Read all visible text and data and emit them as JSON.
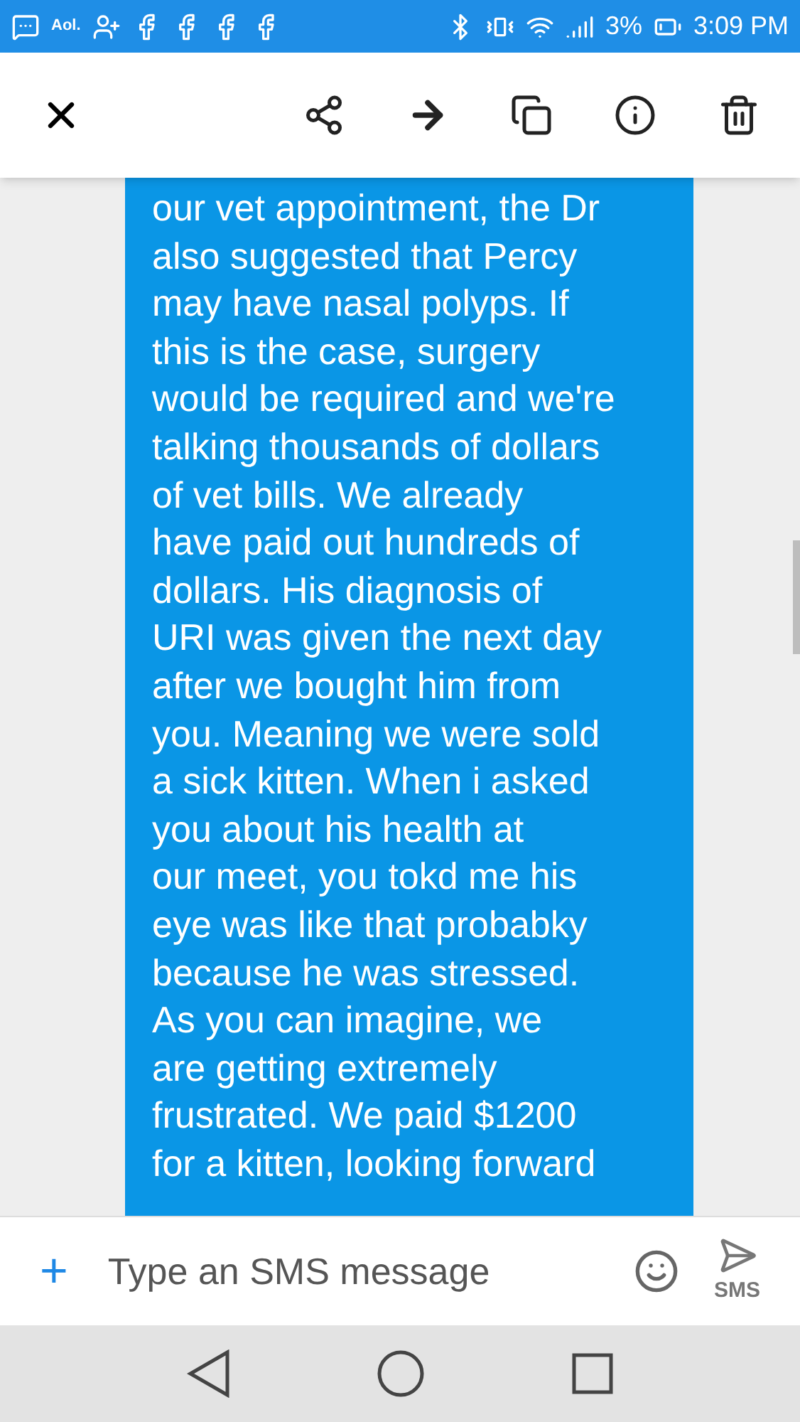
{
  "status_bar": {
    "aol": "Aol.",
    "battery": "3%",
    "time": "3:09 PM"
  },
  "message": {
    "lines": [
      "our vet appointment, the Dr",
      "also suggested that Percy",
      "may have nasal polyps.  If",
      "this is the case, surgery",
      "would be required and we're",
      "talking thousands of dollars",
      "of vet bills. We already",
      "have paid out hundreds of",
      "dollars. His diagnosis of",
      "URI was given the next day",
      "after we bought him from",
      "you.  Meaning we were sold",
      "a sick kitten. When i asked",
      "you about his health at",
      "our meet, you tokd me his",
      "eye was like that probabky",
      "because he was stressed.",
      "As you can imagine,  we",
      "are getting extremely",
      "frustrated. We paid $1200",
      "for a kitten, looking forward"
    ]
  },
  "composer": {
    "add": "+",
    "placeholder": "Type an SMS message",
    "send_label": "SMS"
  }
}
